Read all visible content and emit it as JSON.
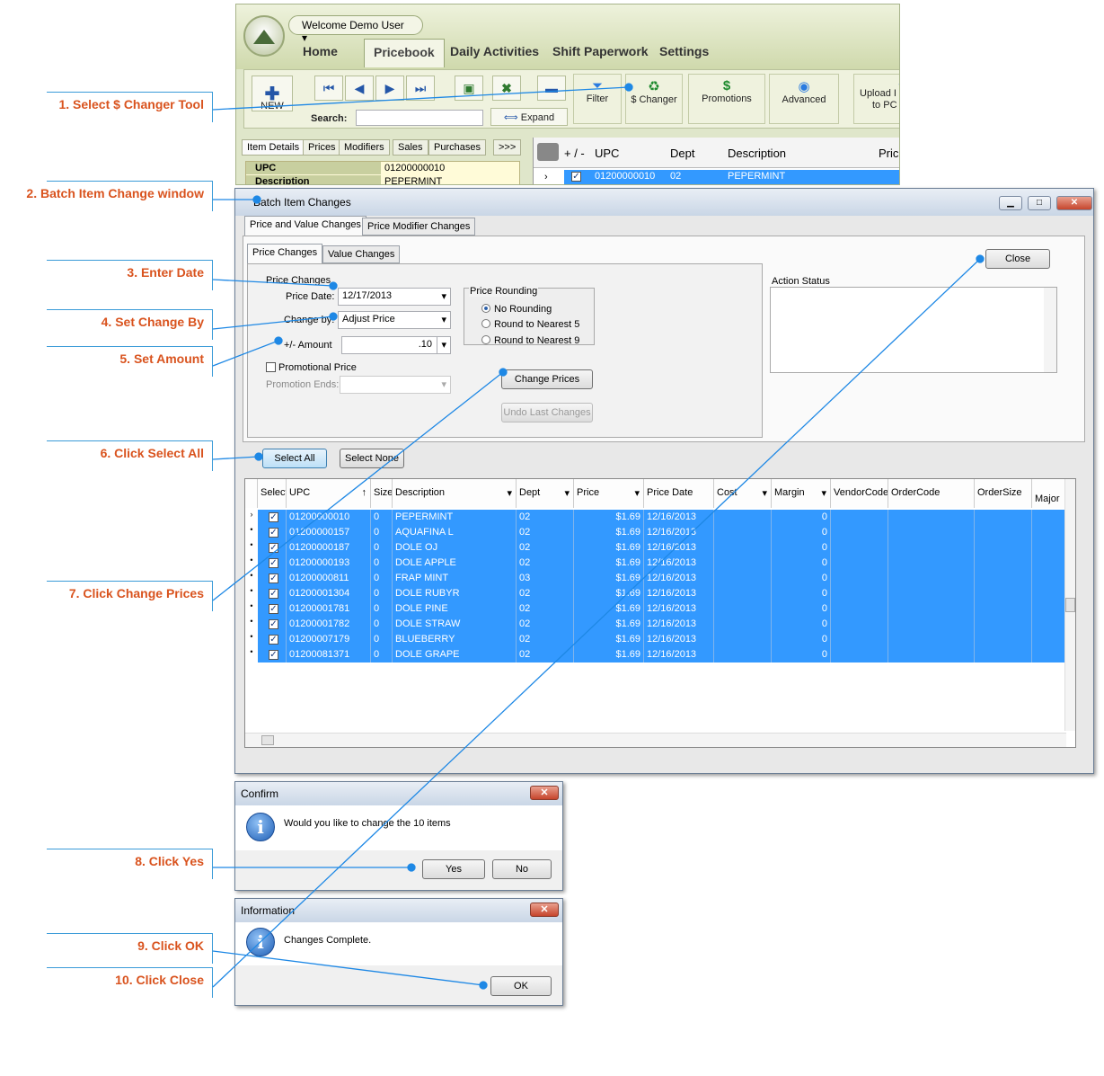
{
  "annotations": {
    "a1": "1. Select $ Changer Tool",
    "a2": "2. Batch Item Change window",
    "a3": "3. Enter Date",
    "a4": "4. Set Change By",
    "a5": "5. Set Amount",
    "a6": "6. Click Select All",
    "a7": "7. Click Change Prices",
    "a8": "8. Click Yes",
    "a9": "9. Click OK",
    "a10": "10. Click Close"
  },
  "app": {
    "welcome": "Welcome Demo User ▾",
    "logo": "APEX",
    "tabs": [
      "Home",
      "Pricebook",
      "Daily Activities",
      "Shift Paperwork",
      "Settings"
    ],
    "toolbar": {
      "new": "NEW",
      "search_label": "Search:",
      "expand": "Expand",
      "filter": "Filter",
      "changer": "$ Changer",
      "promotions": "Promotions",
      "advanced": "Advanced",
      "upload1": "Upload I",
      "upload2": "to PC"
    },
    "detail_tabs": [
      "Item Details",
      "Prices",
      "Modifiers",
      "Sales",
      "Purchases",
      ">>>"
    ],
    "detail_rows": [
      {
        "label": "UPC",
        "value": "01200000010"
      },
      {
        "label": "Description",
        "value": "PEPERMINT"
      }
    ],
    "grid_headers": [
      "+ / -",
      "UPC",
      "Dept",
      "Description",
      "Price"
    ],
    "grid_row": {
      "upc": "01200000010",
      "dept": "02",
      "desc": "PEPERMINT"
    }
  },
  "batch": {
    "title": "Batch Item Changes",
    "tabs": [
      "Price and Value Changes",
      "Price Modifier Changes"
    ],
    "subtabs": [
      "Price Changes",
      "Value Changes"
    ],
    "group_label": "Price Changes",
    "price_date_label": "Price Date:",
    "price_date": "12/17/2013",
    "change_by_label": "Change by:",
    "change_by": "Adjust Price",
    "amount_label": "+/- Amount",
    "amount": ".10",
    "promo_label": "Promotional Price",
    "promo_ends_label": "Promotion Ends:",
    "rounding_label": "Price Rounding",
    "rounding": [
      "No Rounding",
      "Round to Nearest 5",
      "Round to Nearest 9"
    ],
    "change_prices": "Change Prices",
    "undo": "Undo Last Changes",
    "action_status": "Action Status",
    "close": "Close",
    "select_all": "Select All",
    "select_none": "Select None",
    "columns": [
      "Select",
      "UPC",
      "Size",
      "Description",
      "Dept",
      "Price",
      "Price Date",
      "Cost",
      "Margin",
      "VendorCode",
      "OrderCode",
      "OrderSize",
      "Major"
    ],
    "rows": [
      {
        "upc": "01200000010",
        "size": "0",
        "desc": "PEPERMINT",
        "dept": "02",
        "price": "$1.69",
        "date": "12/16/2013",
        "margin": "0"
      },
      {
        "upc": "01200000157",
        "size": "0",
        "desc": "AQUAFINA L",
        "dept": "02",
        "price": "$1.69",
        "date": "12/16/2013",
        "margin": "0"
      },
      {
        "upc": "01200000187",
        "size": "0",
        "desc": "DOLE OJ",
        "dept": "02",
        "price": "$1.69",
        "date": "12/16/2013",
        "margin": "0"
      },
      {
        "upc": "01200000193",
        "size": "0",
        "desc": "DOLE APPLE",
        "dept": "02",
        "price": "$1.69",
        "date": "12/16/2013",
        "margin": "0"
      },
      {
        "upc": "01200000811",
        "size": "0",
        "desc": "FRAP MINT",
        "dept": "03",
        "price": "$1.69",
        "date": "12/16/2013",
        "margin": "0"
      },
      {
        "upc": "01200001304",
        "size": "0",
        "desc": "DOLE RUBYR",
        "dept": "02",
        "price": "$1.69",
        "date": "12/16/2013",
        "margin": "0"
      },
      {
        "upc": "01200001781",
        "size": "0",
        "desc": "DOLE PINE",
        "dept": "02",
        "price": "$1.69",
        "date": "12/16/2013",
        "margin": "0"
      },
      {
        "upc": "01200001782",
        "size": "0",
        "desc": "DOLE STRAW",
        "dept": "02",
        "price": "$1.69",
        "date": "12/16/2013",
        "margin": "0"
      },
      {
        "upc": "01200007179",
        "size": "0",
        "desc": "BLUEBERRY",
        "dept": "02",
        "price": "$1.69",
        "date": "12/16/2013",
        "margin": "0"
      },
      {
        "upc": "01200081371",
        "size": "0",
        "desc": "DOLE GRAPE",
        "dept": "02",
        "price": "$1.69",
        "date": "12/16/2013",
        "margin": "0"
      }
    ]
  },
  "confirm": {
    "title": "Confirm",
    "message": "Would you like to change the 10 items",
    "yes": "Yes",
    "no": "No",
    "icon": "i"
  },
  "information": {
    "title": "Information",
    "message": "Changes Complete.",
    "ok": "OK",
    "icon": "i"
  },
  "colors": {
    "accent": "#3399ff",
    "annotation": "#d9531e",
    "line": "#1e88e5"
  }
}
